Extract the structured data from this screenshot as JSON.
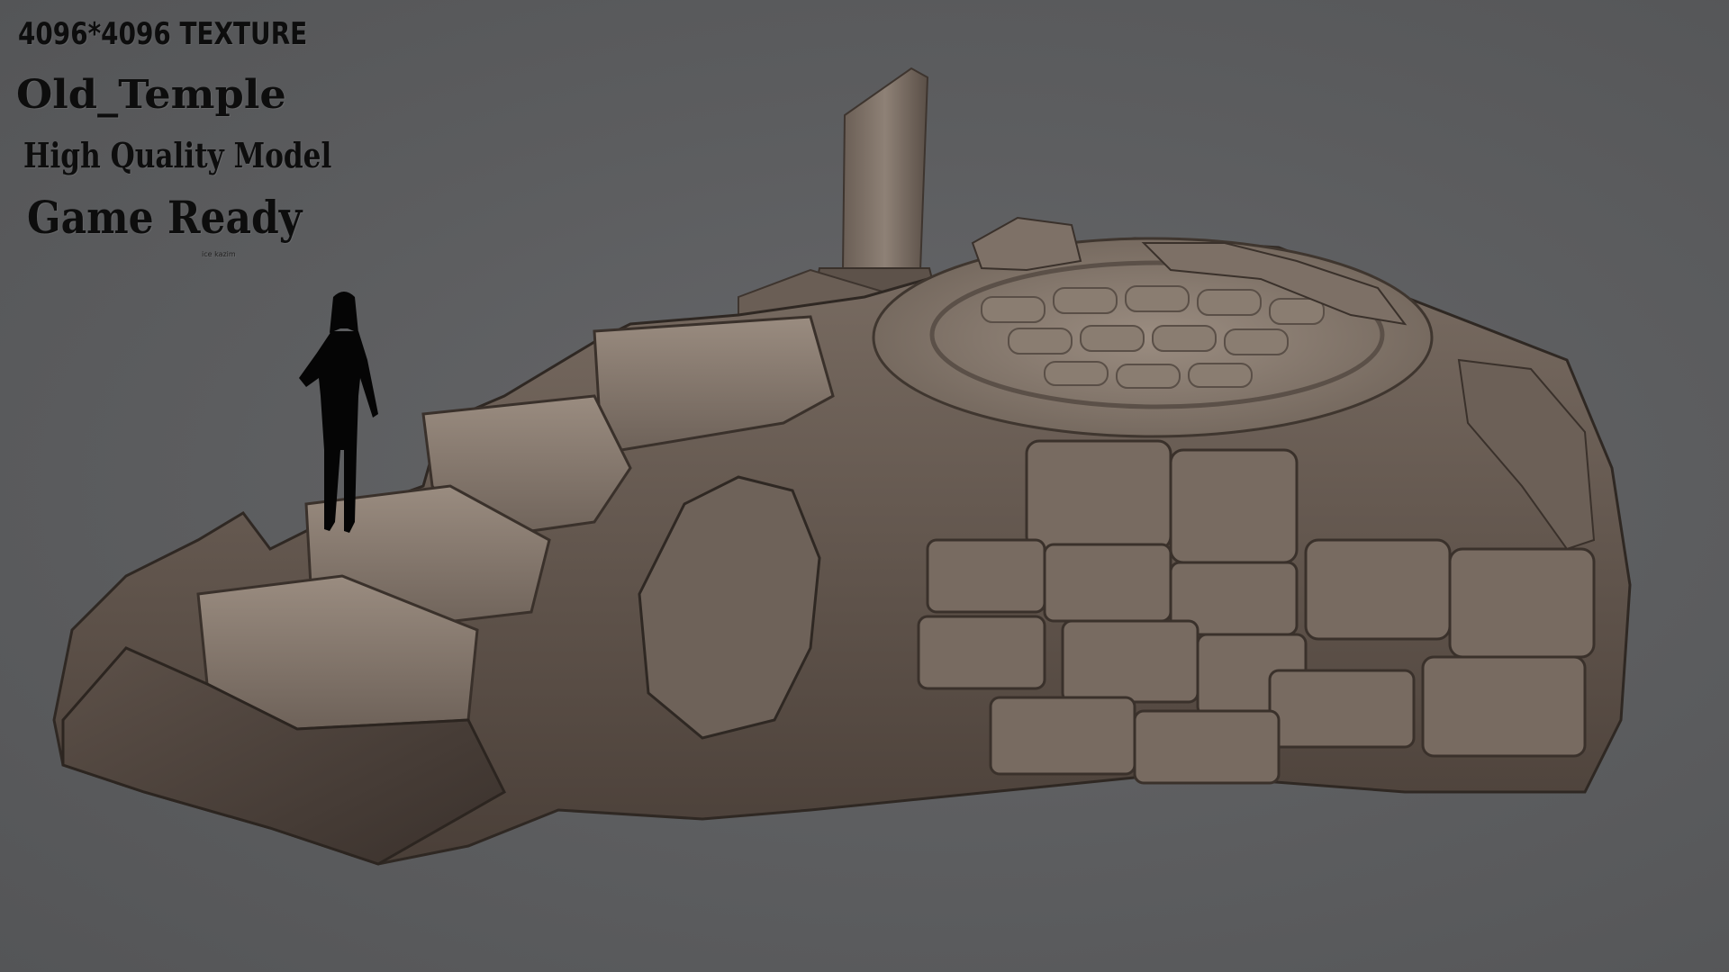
{
  "overlay": {
    "texture_line": "4096*4096 TEXTURE",
    "title": "Old_Temple",
    "quality": "High Quality Model",
    "ready": "Game Ready",
    "credit": "ice kazim"
  },
  "scene": {
    "background_color": "#5b5c5e",
    "subject": "rocky-temple-ruin",
    "scale_reference": "human-silhouette"
  }
}
